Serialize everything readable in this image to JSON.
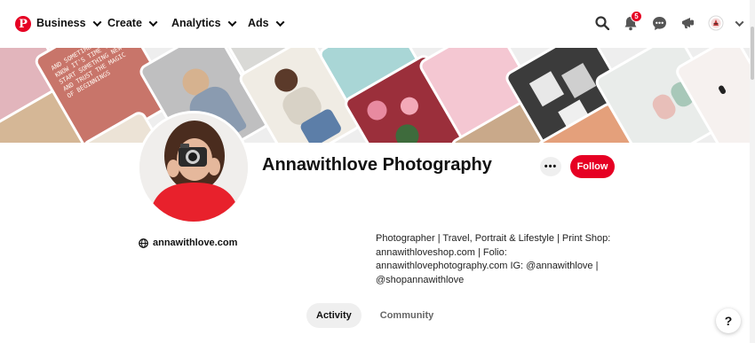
{
  "nav": {
    "logo_glyph": "P",
    "items": [
      {
        "label": "Business"
      },
      {
        "label": "Create"
      },
      {
        "label": "Analytics"
      },
      {
        "label": "Ads"
      }
    ],
    "notification_count": "5"
  },
  "profile": {
    "name": "Annawithlove Photography",
    "more_label": "•••",
    "follow_label": "Follow",
    "website": "annawithlove.com",
    "bio": "Photographer | Travel, Portrait & Lifestyle | Print Shop: annawithloveshop.com | Folio: annawithlovephotography.com IG: @annawithlove | @shopannawithlove",
    "letterboard_text": "AND SOMETIMES YOU KNOW IT'S TIME TO START SOMETHING NEW AND TRUST THE MAGIC OF BEGINNINGS"
  },
  "tabs": [
    {
      "label": "Activity",
      "active": true
    },
    {
      "label": "Community",
      "active": false
    }
  ],
  "help_label": "?",
  "colors": {
    "brand": "#e60023",
    "tab_active_bg": "#efefef"
  }
}
